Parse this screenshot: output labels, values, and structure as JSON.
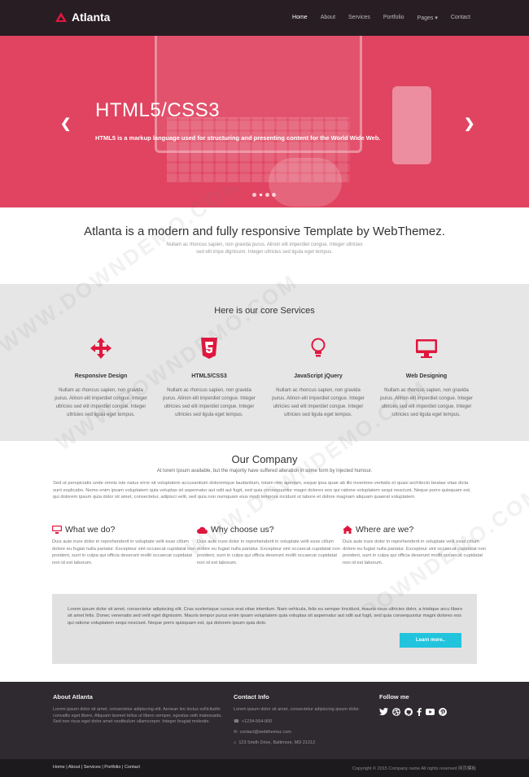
{
  "nav": {
    "brand": "Atlanta",
    "items": [
      "Home",
      "About",
      "Services",
      "Portfolio",
      "Pages",
      "Contact"
    ],
    "pages_caret": "▾"
  },
  "hero": {
    "title": "HTML5/CSS3",
    "text": "HTML5 is a markup language used for structuring and presenting content for the World Wide Web.",
    "prev": "❮",
    "next": "❯"
  },
  "intro": {
    "heading": "Atlanta is a modern and fully responsive Template by WebThemez.",
    "line1": "Nullam ac rhoncus sapien, non gravida purus. Alinon elit imperdiet congue. Integer ultricies",
    "line2": "sed elit impe dignissim. Integer ultricies sed ligula eget tempus."
  },
  "services": {
    "heading": "Here is our core Services",
    "items": [
      {
        "title": "Responsive Design",
        "icon": "arrows-icon",
        "text": "Nullam ac rhoncus sapien, non gravida purus. Alinon elit imperdiet congue. Integer ultricies sed elit imperdiet congue. Integer ultricies sed ligula eget tempus."
      },
      {
        "title": "HTML5/CSS3",
        "icon": "html5-icon",
        "text": "Nullam ac rhoncus sapien, non gravida purus. Alinon elit imperdiet congue. Integer ultricies sed elit imperdiet congue. Integer ultricies sed ligula eget tempus."
      },
      {
        "title": "JavaScript jQuery",
        "icon": "lightbulb-icon",
        "text": "Nullam ac rhoncus sapien, non gravida purus. Alinon elit imperdiet congue. Integer ultricies sed elit imperdiet congue. Integer ultricies sed ligula eget tempus."
      },
      {
        "title": "Web Designing",
        "icon": "desktop-icon",
        "text": "Nullam ac rhoncus sapien, non gravida purus. Alinon elit imperdiet congue. Integer ultricies sed elit imperdiet congue. Integer ultricies sed ligula eget tempus."
      }
    ]
  },
  "company": {
    "heading": "Our Company",
    "sub": "At lorem Ipsum available, but the majority have suffered alteration in some form by injected humour.",
    "para": "Sed ut perspiciatis unde omnis iste natus error sit voluptatem accusantium doloremque laudantium, totam rem aperiam, eaque ipsa quae ab illo inventore veritatis et quasi architecto beatae vitae dicta sunt explicabo. Nemo enim ipsam voluptatem quia voluptas sit aspernatur aut odit aut fugit, sed quia consequuntur magni dolores eos qui ratione voluptatem sequi nesciunt. Neque porro quisquam est, qui dolorem ipsum quia dolor sit amet, consectetur, adipisci velit, sed quia non numquam eius modi tempora incidunt ut labore et dolore magnam aliquam quaerat voluptatem."
  },
  "columns": [
    {
      "title": "What we do?",
      "icon": "desktop-icon",
      "text": "Duis aute irure dolor in reprehenderit in voluptate velit esse cillum dolore eu fugiat nulla pariatur. Excepteur sint occaecat cupidatat non proident, sunt in culpa qui officia deserunt mollit occaecat cupidatat non id est laborum."
    },
    {
      "title": "Why choose us?",
      "icon": "cloud-icon",
      "text": "Duis aute irure dolor in reprehenderit in voluptate velit esse cillum dolore eu fugiat nulla pariatur. Excepteur sint occaecat cupidatat non proident, sunt in culpa qui officia deserunt mollit occaecat cupidatat non id est laborum."
    },
    {
      "title": "Where are we?",
      "icon": "home-icon",
      "text": "Duis aute irure dolor in reprehenderit in voluptate velit esse cillum dolore eu fugiat nulla pariatur. Excepteur sint occaecat cupidatat non proident, sunt in culpa qui officia deserunt mollit occaecat cupidatat non id est laborum."
    }
  ],
  "cta": {
    "text": "Lorem ipsum dolor sit amet, consectetur adipiscing elit. Cras scelerisque cursus erat vitae interdum. Nam vehicula, felis eu semper tincidunt, mauris risus ultricies dolor, a tristique arcu libero sit amet felis. Donec venenatis sed velit eget dignissim. Mauris tempor purus enim ipsam voluptatem quia voluptas sit aspernatur aut odit aut fugit, sed quia consequuntur magni dolores eos qui ratione voluptatem sequi nesciunt. Neque porro quisquam est, qui dolorem ipsum quia dolo.",
    "button": "Learn more.."
  },
  "footer": {
    "about_title": "About Atlanta",
    "about_text": "Lorem ipsum dolor sit amet, consectetur adipiscing elit. Aenean leo lectus sollicitudin convallis eget libero. Aliquam laoreet tellus ut libero semper, egestas velit malesuada. Sed non risus eget dolor amet vestibulum ullamcorper. Integer feugiat molestie.",
    "contact_title": "Contact Info",
    "contact_text": "Lorem ipsum dolor sit amet, consectetur adipiscing ipsum dolor.",
    "phone": "+1234-564-800",
    "email": "contact@webthemez.com",
    "address": "123 Smith Drive, Baltimore, MD 21212",
    "follow_title": "Follow me",
    "social": [
      "twitter-icon",
      "dribbble-icon",
      "github-icon",
      "facebook-icon",
      "youtube-icon",
      "pinterest-icon"
    ]
  },
  "bottom": {
    "links": "Home | About | Services | Portfolio | Contact",
    "copy": "Copyright © 2015 Company name All rights reserved 网页模板"
  },
  "watermark": "WWW.DOWNDEMO.COM",
  "colors": {
    "accent": "#e0163e",
    "hero": "#e04460",
    "cta_button": "#22c4dd",
    "footer": "#2e2a2f"
  }
}
